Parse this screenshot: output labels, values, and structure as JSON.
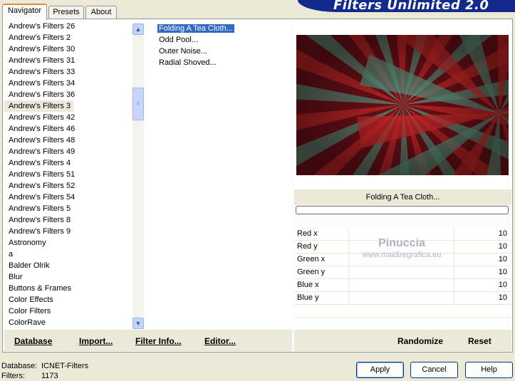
{
  "app": {
    "title": "Filters Unlimited 2.0"
  },
  "tabs": [
    {
      "label": "Navigator"
    },
    {
      "label": "Presets"
    },
    {
      "label": "About"
    }
  ],
  "categories": [
    "Andrew's Filters 26",
    "Andrew's Filters 2",
    "Andrew's Filters 30",
    "Andrew's Filters 31",
    "Andrew's Filters 33",
    "Andrew's Filters 34",
    "Andrew's Filters 36",
    "Andrew's Filters 3",
    "Andrew's Filters 42",
    "Andrew's Filters 46",
    "Andrew's Filters 48",
    "Andrew's Filters 49",
    "Andrew's Filters 4",
    "Andrew's Filters 51",
    "Andrew's Filters 52",
    "Andrew's Filters 54",
    "Andrew's Filters 5",
    "Andrew's Filters 8",
    "Andrew's Filters 9",
    "Astronomy",
    "a",
    "Balder Olrik",
    "Blur",
    "Buttons & Frames",
    "Color Effects",
    "Color Filters",
    "ColorRave"
  ],
  "selected_category": "Andrew's Filters 3",
  "filters": [
    "Folding A Tea Cloth...",
    "Odd Pool...",
    "Outer Noise...",
    "Radial Shoved..."
  ],
  "selected_filter": "Folding A Tea Cloth...",
  "preview": {
    "caption": "Folding A Tea Cloth...",
    "colors": [
      "#d42a2a",
      "#5e9680",
      "#6e1018"
    ]
  },
  "params": [
    {
      "label": "Red x",
      "value": "10"
    },
    {
      "label": "Red y",
      "value": "10"
    },
    {
      "label": "Green x",
      "value": "10"
    },
    {
      "label": "Green y",
      "value": "10"
    },
    {
      "label": "Blue x",
      "value": "10"
    },
    {
      "label": "Blue y",
      "value": "10"
    }
  ],
  "watermark": {
    "line1": "Pinuccia",
    "line2": "www.maidiregrafica.eu"
  },
  "left_buttons": {
    "database": "Database",
    "import": "Import...",
    "filter_info": "Filter Info...",
    "editor": "Editor..."
  },
  "right_buttons": {
    "randomize": "Randomize",
    "reset": "Reset"
  },
  "status": {
    "database_label": "Database:",
    "database_value": "ICNET-Filters",
    "filters_label": "Filters:",
    "filters_value": "1173"
  },
  "dialog_buttons": {
    "apply": "Apply",
    "cancel": "Cancel",
    "help": "Help"
  }
}
